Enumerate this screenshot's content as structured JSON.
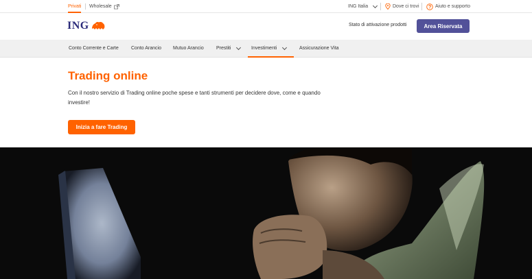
{
  "topbar": {
    "privati": "Privati",
    "wholesale": "Wholesale",
    "ing_italia": "ING Italia",
    "dove_ci_trovi": "Dove ci trovi",
    "aiuto": "Aiuto e supporto"
  },
  "header": {
    "logo": "ING",
    "stato_link": "Stato di attivazione prodotti",
    "area_riservata": "Area Riservata"
  },
  "nav": {
    "items": [
      {
        "label": "Conto Corrente e Carte"
      },
      {
        "label": "Conto Arancio"
      },
      {
        "label": "Mutuo Arancio"
      },
      {
        "label": "Prestiti"
      },
      {
        "label": "Investimenti"
      },
      {
        "label": "Assicurazione Vita"
      }
    ],
    "active": "Investimenti"
  },
  "hero": {
    "title": "Trading online",
    "description": "Con il nostro servizio di Trading online poche spese e tanti strumenti per decidere dove, come e quando investire!",
    "cta": "Inizia a fare Trading"
  },
  "colors": {
    "brand_orange": "#ff6200",
    "brand_purple": "#525199",
    "logo_navy": "#2b2b7a"
  },
  "icons": [
    "external-link-icon",
    "chevron-down-icon",
    "location-pin-icon",
    "help-circle-icon",
    "ing-lion-icon"
  ]
}
